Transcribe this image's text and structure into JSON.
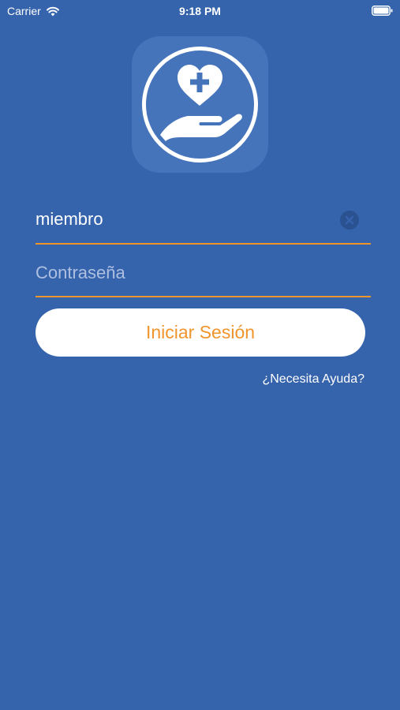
{
  "status_bar": {
    "carrier": "Carrier",
    "time": "9:18 PM",
    "wifi_icon": "wifi-icon",
    "battery_icon": "battery-icon"
  },
  "logo": {
    "icon": "heart-plus-hand-icon",
    "tile_color": "#4574bb"
  },
  "login_form": {
    "username_value": "miembro",
    "clear_icon": "clear-circle-icon",
    "password_placeholder": "Contraseña",
    "submit_label": "Iniciar Sesión",
    "help_link": "¿Necesita Ayuda?"
  },
  "colors": {
    "background": "#3564ad",
    "accent": "#f0952b",
    "button_bg": "#ffffff"
  }
}
